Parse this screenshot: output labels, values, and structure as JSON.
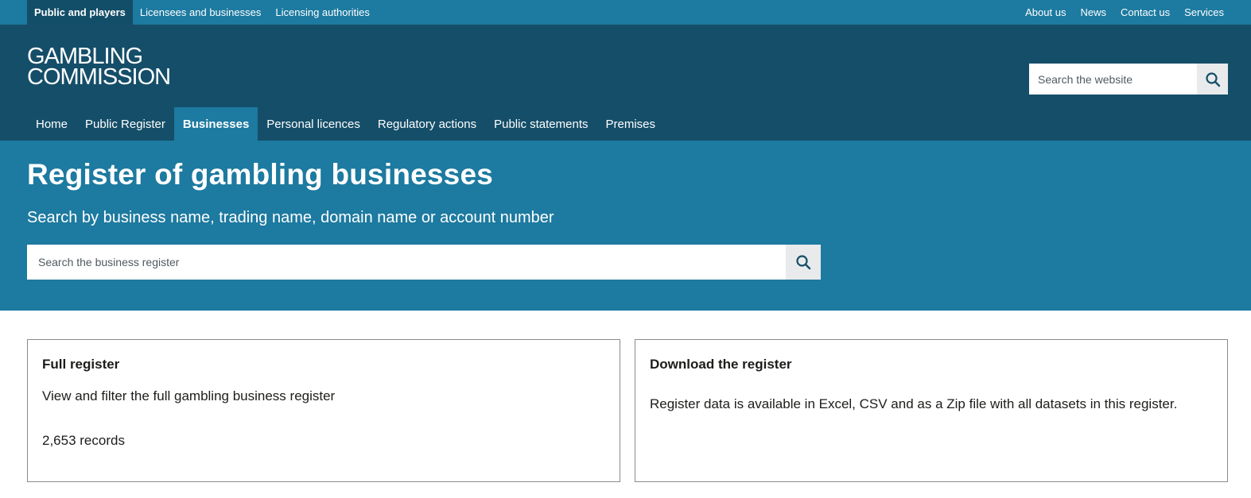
{
  "utility_nav": {
    "left": [
      "Public and players",
      "Licensees and businesses",
      "Licensing authorities"
    ],
    "right": [
      "About us",
      "News",
      "Contact us",
      "Services"
    ]
  },
  "logo": {
    "line1": "GAMBLING",
    "line2": "COMMISSION"
  },
  "site_search": {
    "placeholder": "Search the website",
    "icon": "search-icon"
  },
  "main_nav": {
    "items": [
      "Home",
      "Public Register",
      "Businesses",
      "Personal licences",
      "Regulatory actions",
      "Public statements",
      "Premises"
    ],
    "active": "Businesses"
  },
  "hero": {
    "title": "Register of gambling businesses",
    "subtitle": "Search by business name, trading name, domain name or account number",
    "search_placeholder": "Search the business register"
  },
  "cards": [
    {
      "title": "Full register",
      "description": "View and filter the full gambling business register",
      "count": "2,653 records"
    },
    {
      "title": "Download the register",
      "description": "Register data is available in Excel, CSV and as a Zip file with all datasets in this register."
    }
  ],
  "colors": {
    "utility_bg": "#1d7aa0",
    "header_bg": "#154e69",
    "hero_bg": "#1d7aa0",
    "active_nav": "#1d7aa0"
  }
}
